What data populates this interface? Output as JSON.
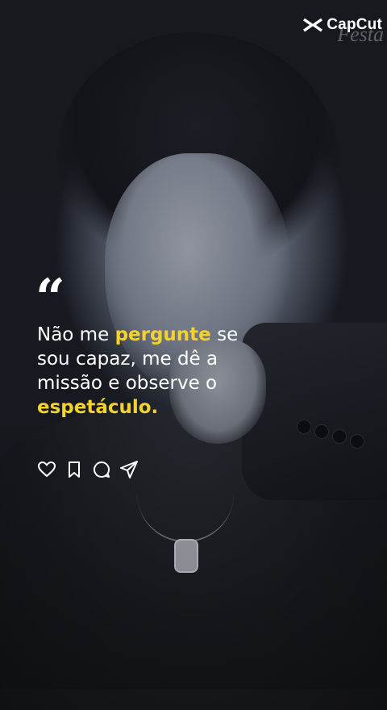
{
  "brand": {
    "name": "CapCut",
    "watermark": "Festa"
  },
  "quote": {
    "mark": "“",
    "segments": [
      {
        "text": "Não me ",
        "highlight": false
      },
      {
        "text": "pergunte",
        "highlight": true
      },
      {
        "text": " se sou capaz, me dê a missão e observe o ",
        "highlight": false
      },
      {
        "text": "espetáculo.",
        "highlight": true
      }
    ],
    "highlight_color": "#f2d22b"
  },
  "actions": [
    {
      "name": "like-button",
      "icon": "heart-icon"
    },
    {
      "name": "save-button",
      "icon": "bookmark-icon"
    },
    {
      "name": "comment-button",
      "icon": "comment-icon"
    },
    {
      "name": "share-button",
      "icon": "send-icon"
    }
  ]
}
